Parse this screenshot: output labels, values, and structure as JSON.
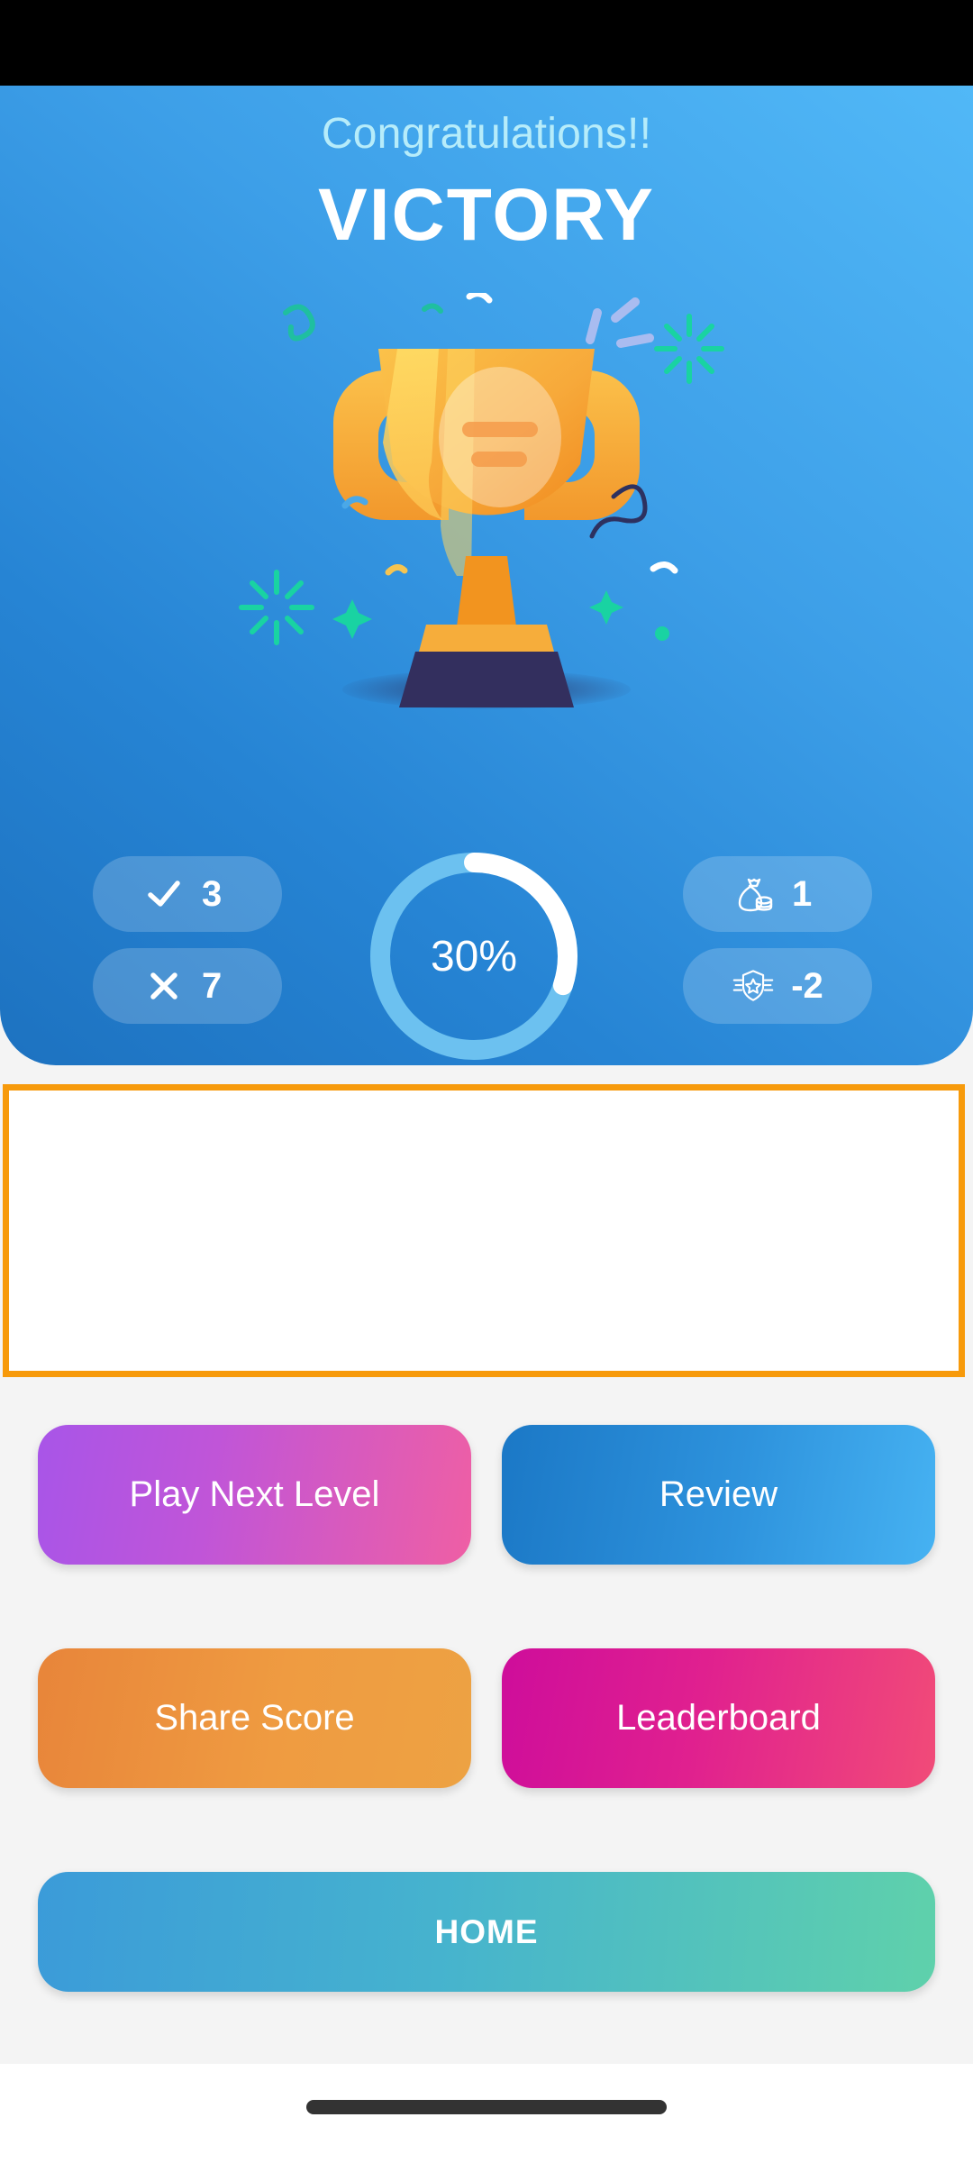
{
  "screen": {
    "name": "victory-result-screen",
    "background_color": "#f4f4f4"
  },
  "hero": {
    "subtitle": "Congratulations!!",
    "title": "VICTORY",
    "subtitle_color": "#b6ecfa",
    "title_color": "#ffffff",
    "gradient_from": "#51b8f7",
    "gradient_to": "#1d72c0",
    "illustration": "trophy-illustration"
  },
  "stats": {
    "left": [
      {
        "icon": "check-icon",
        "label": "correct-answers",
        "value": "3"
      },
      {
        "icon": "cross-icon",
        "label": "wrong-answers",
        "value": "7"
      }
    ],
    "right": [
      {
        "icon": "money-bag-icon",
        "label": "coins-earned",
        "value": "1"
      },
      {
        "icon": "rank-badge-icon",
        "label": "rank-change",
        "value": "-2"
      }
    ]
  },
  "progress": {
    "percent_label": "30%",
    "percent_value": 30,
    "track_color": "#6cc1f0",
    "fill_color": "#ffffff"
  },
  "ad": {
    "name": "ad-placeholder",
    "border_color": "#f79a0b",
    "background_color": "#ffffff",
    "content": ""
  },
  "buttons": {
    "play_next_level": "Play Next Level",
    "review": "Review",
    "share_score": "Share Score",
    "leaderboard": "Leaderboard",
    "home": "HOME",
    "colors": {
      "play_next_level": "#c055d8",
      "review": "#2e93dd",
      "share_score": "#ef9b41",
      "leaderboard": "#e0208f",
      "home": "#46b3ce"
    }
  },
  "nav": {
    "gesture_bar": "home-gesture-bar"
  }
}
